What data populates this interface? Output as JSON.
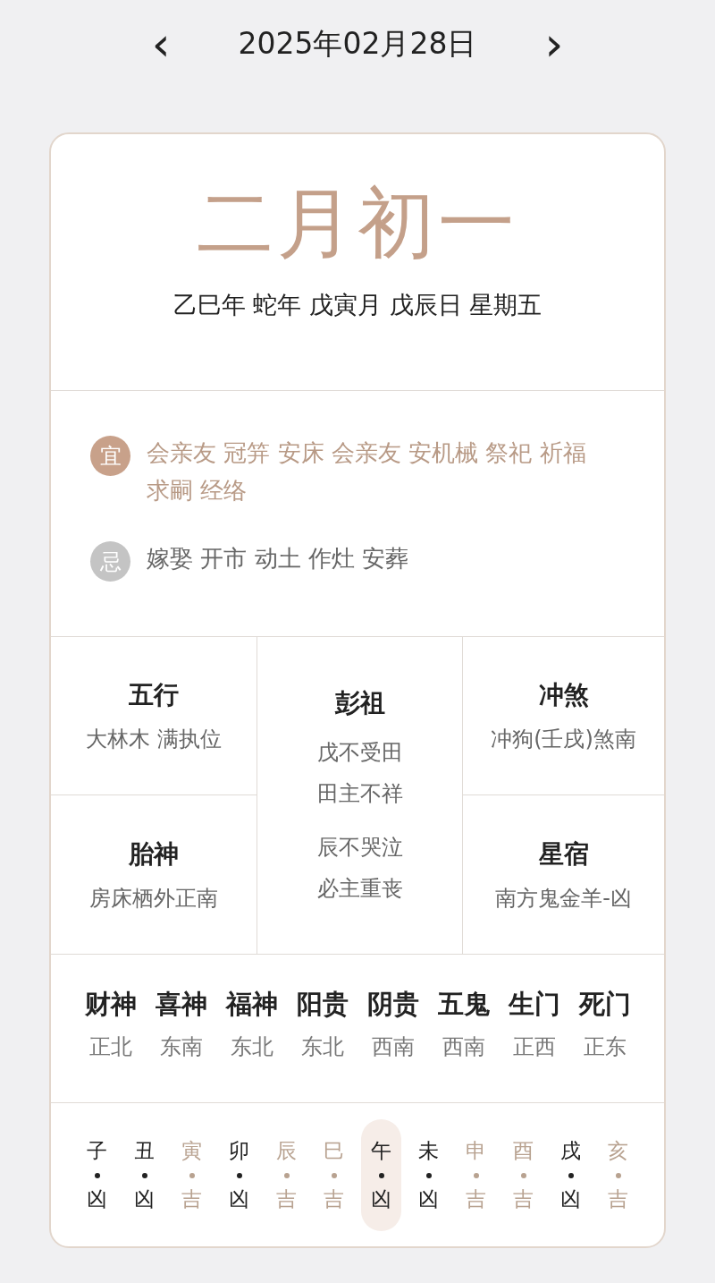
{
  "header": {
    "prev": "‹",
    "date": "2025年02月28日",
    "next": "›"
  },
  "lunar": {
    "date": "二月初一",
    "ganzhi": "乙巳年 蛇年 戊寅月 戊辰日 星期五"
  },
  "advice": [
    {
      "kind": "good",
      "badge": "宜",
      "text": "会亲友 冠笄 安床 会亲友 安机械 祭祀 祈福求嗣 经络"
    },
    {
      "kind": "bad",
      "badge": "忌",
      "text": "嫁娶 开市 动土 作灶 安葬"
    }
  ],
  "info": {
    "left": [
      {
        "title": "五行",
        "value": "大林木 满执位"
      },
      {
        "title": "胎神",
        "value": "房床栖外正南"
      }
    ],
    "center": {
      "title": "彭祖",
      "lines": [
        "戊不受田",
        "田主不祥",
        "辰不哭泣",
        "必主重丧"
      ]
    },
    "right": [
      {
        "title": "冲煞",
        "value": "冲狗(壬戌)煞南"
      },
      {
        "title": "星宿",
        "value": "南方鬼金羊-凶"
      }
    ]
  },
  "gods": [
    {
      "name": "财神",
      "direction": "正北"
    },
    {
      "name": "喜神",
      "direction": "东南"
    },
    {
      "name": "福神",
      "direction": "东北"
    },
    {
      "name": "阳贵",
      "direction": "东北"
    },
    {
      "name": "阴贵",
      "direction": "西南"
    },
    {
      "name": "五鬼",
      "direction": "西南"
    },
    {
      "name": "生门",
      "direction": "正西"
    },
    {
      "name": "死门",
      "direction": "正东"
    }
  ],
  "hours": [
    {
      "branch": "子",
      "verdict": "凶",
      "color": "#222222",
      "selected": false
    },
    {
      "branch": "丑",
      "verdict": "凶",
      "color": "#222222",
      "selected": false
    },
    {
      "branch": "寅",
      "verdict": "吉",
      "color": "#b8a290",
      "selected": false
    },
    {
      "branch": "卯",
      "verdict": "凶",
      "color": "#222222",
      "selected": false
    },
    {
      "branch": "辰",
      "verdict": "吉",
      "color": "#b8a290",
      "selected": false
    },
    {
      "branch": "巳",
      "verdict": "吉",
      "color": "#b8a290",
      "selected": false
    },
    {
      "branch": "午",
      "verdict": "凶",
      "color": "#222222",
      "selected": true
    },
    {
      "branch": "未",
      "verdict": "凶",
      "color": "#222222",
      "selected": false
    },
    {
      "branch": "申",
      "verdict": "吉",
      "color": "#b8a290",
      "selected": false
    },
    {
      "branch": "酉",
      "verdict": "吉",
      "color": "#b8a290",
      "selected": false
    },
    {
      "branch": "戌",
      "verdict": "凶",
      "color": "#222222",
      "selected": false
    },
    {
      "branch": "亥",
      "verdict": "吉",
      "color": "#b8a290",
      "selected": false
    }
  ]
}
